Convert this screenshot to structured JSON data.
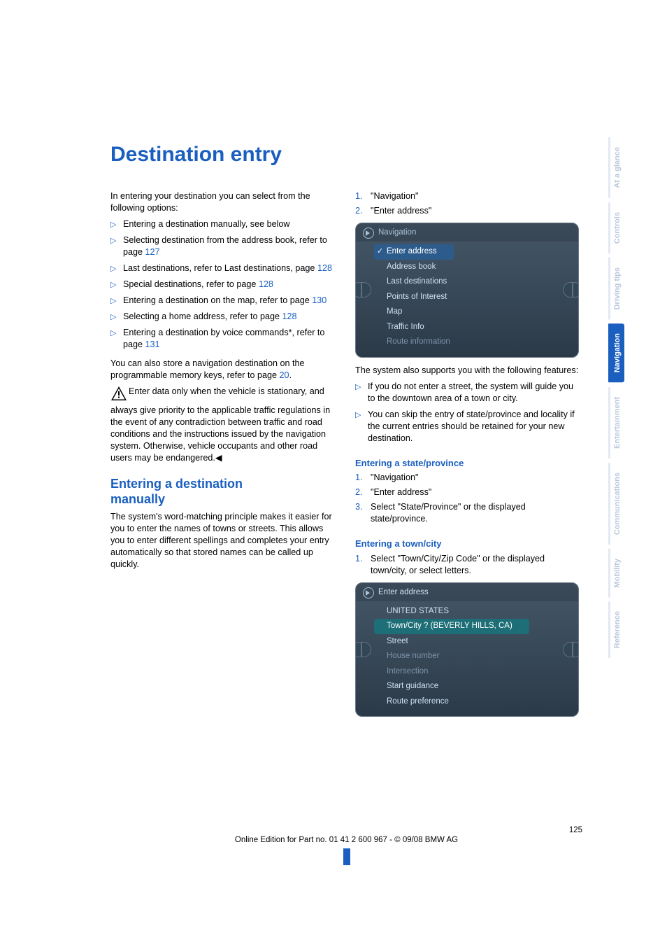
{
  "title": "Destination entry",
  "left": {
    "intro": "In entering your destination you can select from the following options:",
    "options": [
      {
        "text": "Entering a destination manually, see below"
      },
      {
        "text": "Selecting destination from the address book, refer to page ",
        "link": "127"
      },
      {
        "text": "Last destinations, refer to Last destinations, page ",
        "link": "128"
      },
      {
        "text": "Special destinations, refer to page ",
        "link": "128"
      },
      {
        "text": "Entering a destination on the map, refer to page ",
        "link": "130"
      },
      {
        "text": "Selecting a home address, refer to page ",
        "link": "128"
      },
      {
        "text": "Entering a destination by voice commands*, refer to page ",
        "link": "131"
      }
    ],
    "store": {
      "a": "You can also store a navigation destination on the programmable memory keys, refer to page ",
      "link": "20",
      "b": "."
    },
    "warn": "Enter data only when the vehicle is stationary, and always give priority to the applicable traffic regulations in the event of any contradiction between traffic and road conditions and the instructions issued by the navigation system. Otherwise, vehicle occupants and other road users may be endangered.◀",
    "h2a": "Entering a destination",
    "h2b": "manually",
    "manual_para": "The system's word-matching principle makes it easier for you to enter the names of towns or streets. This allows you to enter different spellings and completes your entry automatically so that stored names can be called up quickly."
  },
  "right": {
    "steps1": [
      {
        "n": "1.",
        "t": "\"Navigation\""
      },
      {
        "n": "2.",
        "t": "\"Enter address\""
      }
    ],
    "menu1": {
      "title": "Navigation",
      "items": [
        {
          "label": "Enter address",
          "sel": true,
          "check": true
        },
        {
          "label": "Address book"
        },
        {
          "label": "Last destinations"
        },
        {
          "label": "Points of Interest"
        },
        {
          "label": "Map"
        },
        {
          "label": "Traffic Info"
        },
        {
          "label": "Route information",
          "dim": true
        }
      ]
    },
    "support_intro": "The system also supports you with the following features:",
    "support_items": [
      "If you do not enter a street, the system will guide you to the downtown area of a town or city.",
      "You can skip the entry of state/province and locality if the current entries should be retained for your new destination."
    ],
    "h_state": "Entering a state/province",
    "steps_state": [
      {
        "n": "1.",
        "t": "\"Navigation\""
      },
      {
        "n": "2.",
        "t": "\"Enter address\""
      },
      {
        "n": "3.",
        "t": "Select \"State/Province\" or the displayed state/province."
      }
    ],
    "h_town": "Entering a town/city",
    "steps_town": [
      {
        "n": "1.",
        "t": "Select \"Town/City/Zip Code\" or the displayed town/city, or select letters."
      }
    ],
    "menu2": {
      "title": "Enter address",
      "items": [
        {
          "label": "UNITED STATES"
        },
        {
          "label": "Town/City ? (BEVERLY HILLS, CA)",
          "sel": true
        },
        {
          "label": "Street"
        },
        {
          "label": "House number",
          "dim": true
        },
        {
          "label": "Intersection",
          "dim": true
        },
        {
          "label": "Start guidance"
        },
        {
          "label": "Route preference"
        }
      ]
    }
  },
  "tabs": [
    {
      "label": "At a glance"
    },
    {
      "label": "Controls"
    },
    {
      "label": "Driving tips"
    },
    {
      "label": "Navigation",
      "active": true
    },
    {
      "label": "Entertainment"
    },
    {
      "label": "Communications"
    },
    {
      "label": "Mobility"
    },
    {
      "label": "Reference"
    }
  ],
  "footer": {
    "page": "125",
    "line": "Online Edition for Part no. 01 41 2 600 967  - © 09/08 BMW AG"
  }
}
